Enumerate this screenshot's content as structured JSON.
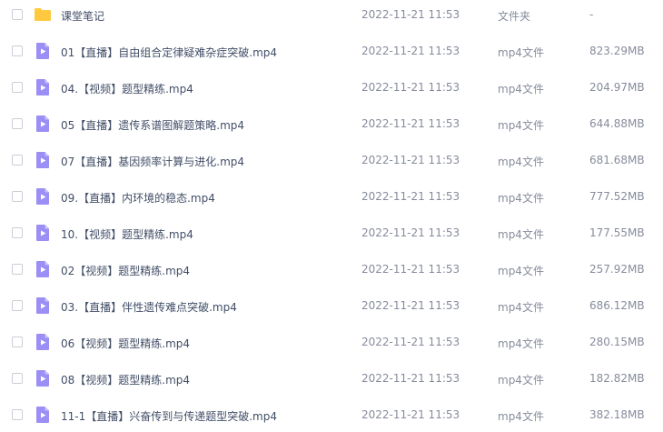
{
  "files": [
    {
      "icon": "folder-icon",
      "name": "课堂笔记",
      "date": "2022-11-21 11:53",
      "type": "文件夹",
      "size": "-"
    },
    {
      "icon": "video-file-icon",
      "name": "01【直播】自由组合定律疑难杂症突破.mp4",
      "date": "2022-11-21 11:53",
      "type": "mp4文件",
      "size": "823.29MB"
    },
    {
      "icon": "video-file-icon",
      "name": "04.【视频】题型精练.mp4",
      "date": "2022-11-21 11:53",
      "type": "mp4文件",
      "size": "204.97MB"
    },
    {
      "icon": "video-file-icon",
      "name": "05【直播】遗传系谱图解题策略.mp4",
      "date": "2022-11-21 11:53",
      "type": "mp4文件",
      "size": "644.88MB"
    },
    {
      "icon": "video-file-icon",
      "name": "07【直播】基因频率计算与进化.mp4",
      "date": "2022-11-21 11:53",
      "type": "mp4文件",
      "size": "681.68MB"
    },
    {
      "icon": "video-file-icon",
      "name": "09.【直播】内环境的稳态.mp4",
      "date": "2022-11-21 11:53",
      "type": "mp4文件",
      "size": "777.52MB"
    },
    {
      "icon": "video-file-icon",
      "name": "10.【视频】题型精练.mp4",
      "date": "2022-11-21 11:53",
      "type": "mp4文件",
      "size": "177.55MB"
    },
    {
      "icon": "video-file-icon",
      "name": "02【视频】题型精练.mp4",
      "date": "2022-11-21 11:53",
      "type": "mp4文件",
      "size": "257.92MB"
    },
    {
      "icon": "video-file-icon",
      "name": "03.【直播】伴性遗传难点突破.mp4",
      "date": "2022-11-21 11:53",
      "type": "mp4文件",
      "size": "686.12MB"
    },
    {
      "icon": "video-file-icon",
      "name": "06【视频】题型精练.mp4",
      "date": "2022-11-21 11:53",
      "type": "mp4文件",
      "size": "280.15MB"
    },
    {
      "icon": "video-file-icon",
      "name": "08【视频】题型精练.mp4",
      "date": "2022-11-21 11:53",
      "type": "mp4文件",
      "size": "182.82MB"
    },
    {
      "icon": "video-file-icon",
      "name": "11-1【直播】兴奋传到与传递题型突破.mp4",
      "date": "2022-11-21 11:53",
      "type": "mp4文件",
      "size": "382.18MB"
    }
  ],
  "colors": {
    "folder": "#ffc940",
    "video_icon": "#9b8ef4",
    "video_icon_fold": "#c9c1fa",
    "checkbox_border": "#c9ced6",
    "name_text": "#424e67",
    "meta_text": "#878c9c"
  }
}
